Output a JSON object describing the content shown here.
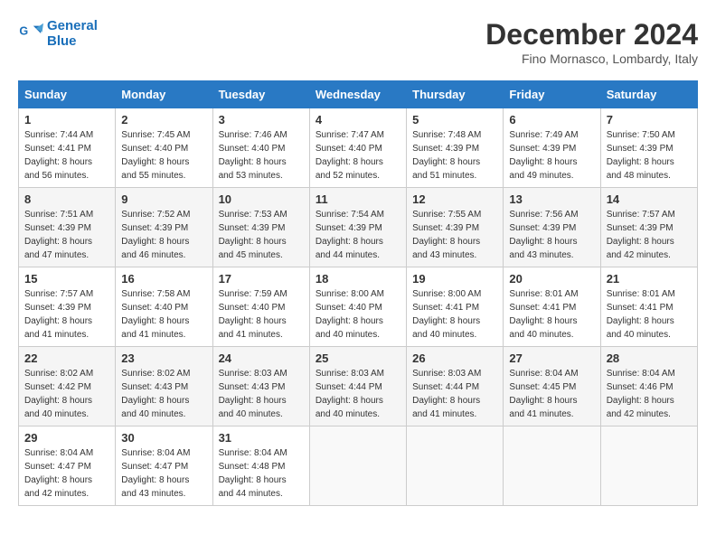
{
  "header": {
    "logo_line1": "General",
    "logo_line2": "Blue",
    "month": "December 2024",
    "location": "Fino Mornasco, Lombardy, Italy"
  },
  "days_of_week": [
    "Sunday",
    "Monday",
    "Tuesday",
    "Wednesday",
    "Thursday",
    "Friday",
    "Saturday"
  ],
  "weeks": [
    [
      {
        "day": "1",
        "info": "Sunrise: 7:44 AM\nSunset: 4:41 PM\nDaylight: 8 hours\nand 56 minutes."
      },
      {
        "day": "2",
        "info": "Sunrise: 7:45 AM\nSunset: 4:40 PM\nDaylight: 8 hours\nand 55 minutes."
      },
      {
        "day": "3",
        "info": "Sunrise: 7:46 AM\nSunset: 4:40 PM\nDaylight: 8 hours\nand 53 minutes."
      },
      {
        "day": "4",
        "info": "Sunrise: 7:47 AM\nSunset: 4:40 PM\nDaylight: 8 hours\nand 52 minutes."
      },
      {
        "day": "5",
        "info": "Sunrise: 7:48 AM\nSunset: 4:39 PM\nDaylight: 8 hours\nand 51 minutes."
      },
      {
        "day": "6",
        "info": "Sunrise: 7:49 AM\nSunset: 4:39 PM\nDaylight: 8 hours\nand 49 minutes."
      },
      {
        "day": "7",
        "info": "Sunrise: 7:50 AM\nSunset: 4:39 PM\nDaylight: 8 hours\nand 48 minutes."
      }
    ],
    [
      {
        "day": "8",
        "info": "Sunrise: 7:51 AM\nSunset: 4:39 PM\nDaylight: 8 hours\nand 47 minutes."
      },
      {
        "day": "9",
        "info": "Sunrise: 7:52 AM\nSunset: 4:39 PM\nDaylight: 8 hours\nand 46 minutes."
      },
      {
        "day": "10",
        "info": "Sunrise: 7:53 AM\nSunset: 4:39 PM\nDaylight: 8 hours\nand 45 minutes."
      },
      {
        "day": "11",
        "info": "Sunrise: 7:54 AM\nSunset: 4:39 PM\nDaylight: 8 hours\nand 44 minutes."
      },
      {
        "day": "12",
        "info": "Sunrise: 7:55 AM\nSunset: 4:39 PM\nDaylight: 8 hours\nand 43 minutes."
      },
      {
        "day": "13",
        "info": "Sunrise: 7:56 AM\nSunset: 4:39 PM\nDaylight: 8 hours\nand 43 minutes."
      },
      {
        "day": "14",
        "info": "Sunrise: 7:57 AM\nSunset: 4:39 PM\nDaylight: 8 hours\nand 42 minutes."
      }
    ],
    [
      {
        "day": "15",
        "info": "Sunrise: 7:57 AM\nSunset: 4:39 PM\nDaylight: 8 hours\nand 41 minutes."
      },
      {
        "day": "16",
        "info": "Sunrise: 7:58 AM\nSunset: 4:40 PM\nDaylight: 8 hours\nand 41 minutes."
      },
      {
        "day": "17",
        "info": "Sunrise: 7:59 AM\nSunset: 4:40 PM\nDaylight: 8 hours\nand 41 minutes."
      },
      {
        "day": "18",
        "info": "Sunrise: 8:00 AM\nSunset: 4:40 PM\nDaylight: 8 hours\nand 40 minutes."
      },
      {
        "day": "19",
        "info": "Sunrise: 8:00 AM\nSunset: 4:41 PM\nDaylight: 8 hours\nand 40 minutes."
      },
      {
        "day": "20",
        "info": "Sunrise: 8:01 AM\nSunset: 4:41 PM\nDaylight: 8 hours\nand 40 minutes."
      },
      {
        "day": "21",
        "info": "Sunrise: 8:01 AM\nSunset: 4:41 PM\nDaylight: 8 hours\nand 40 minutes."
      }
    ],
    [
      {
        "day": "22",
        "info": "Sunrise: 8:02 AM\nSunset: 4:42 PM\nDaylight: 8 hours\nand 40 minutes."
      },
      {
        "day": "23",
        "info": "Sunrise: 8:02 AM\nSunset: 4:43 PM\nDaylight: 8 hours\nand 40 minutes."
      },
      {
        "day": "24",
        "info": "Sunrise: 8:03 AM\nSunset: 4:43 PM\nDaylight: 8 hours\nand 40 minutes."
      },
      {
        "day": "25",
        "info": "Sunrise: 8:03 AM\nSunset: 4:44 PM\nDaylight: 8 hours\nand 40 minutes."
      },
      {
        "day": "26",
        "info": "Sunrise: 8:03 AM\nSunset: 4:44 PM\nDaylight: 8 hours\nand 41 minutes."
      },
      {
        "day": "27",
        "info": "Sunrise: 8:04 AM\nSunset: 4:45 PM\nDaylight: 8 hours\nand 41 minutes."
      },
      {
        "day": "28",
        "info": "Sunrise: 8:04 AM\nSunset: 4:46 PM\nDaylight: 8 hours\nand 42 minutes."
      }
    ],
    [
      {
        "day": "29",
        "info": "Sunrise: 8:04 AM\nSunset: 4:47 PM\nDaylight: 8 hours\nand 42 minutes."
      },
      {
        "day": "30",
        "info": "Sunrise: 8:04 AM\nSunset: 4:47 PM\nDaylight: 8 hours\nand 43 minutes."
      },
      {
        "day": "31",
        "info": "Sunrise: 8:04 AM\nSunset: 4:48 PM\nDaylight: 8 hours\nand 44 minutes."
      },
      {
        "day": "",
        "info": ""
      },
      {
        "day": "",
        "info": ""
      },
      {
        "day": "",
        "info": ""
      },
      {
        "day": "",
        "info": ""
      }
    ]
  ]
}
